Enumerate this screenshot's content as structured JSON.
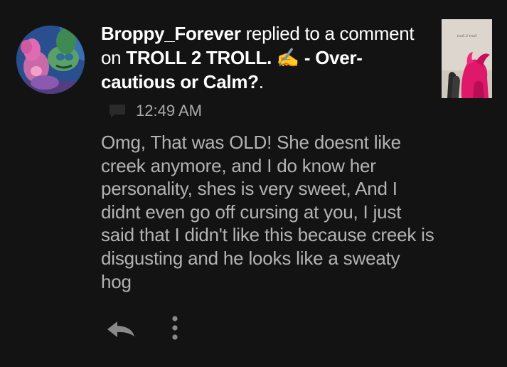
{
  "notification": {
    "username": "Broppy_Forever",
    "action_text": " replied to a comment on ",
    "post_title": "TROLL 2 TROLL. ✍ - Over-cautious or Calm?",
    "trailing_punct": ".",
    "timestamp": "12:49 AM",
    "comment_text": "Omg, That was OLD! She doesnt like creek anymore, and I do know her personality, shes is very sweet, And I didnt even go off cursing at you, I just said that I didn't like this because creek is disgusting and he looks like a sweaty hog",
    "thumbnail_caption": "troll 2 troll"
  },
  "icons": {
    "timestamp_icon": "chat-bubble-icon",
    "reply_icon": "reply-arrow-icon",
    "more_icon": "more-vertical-icon"
  },
  "colors": {
    "background": "#131313",
    "headline_text": "#ffffff",
    "body_text": "#b3b3b3",
    "meta_text": "#aaaaaa",
    "icon": "#8a8a8a"
  }
}
